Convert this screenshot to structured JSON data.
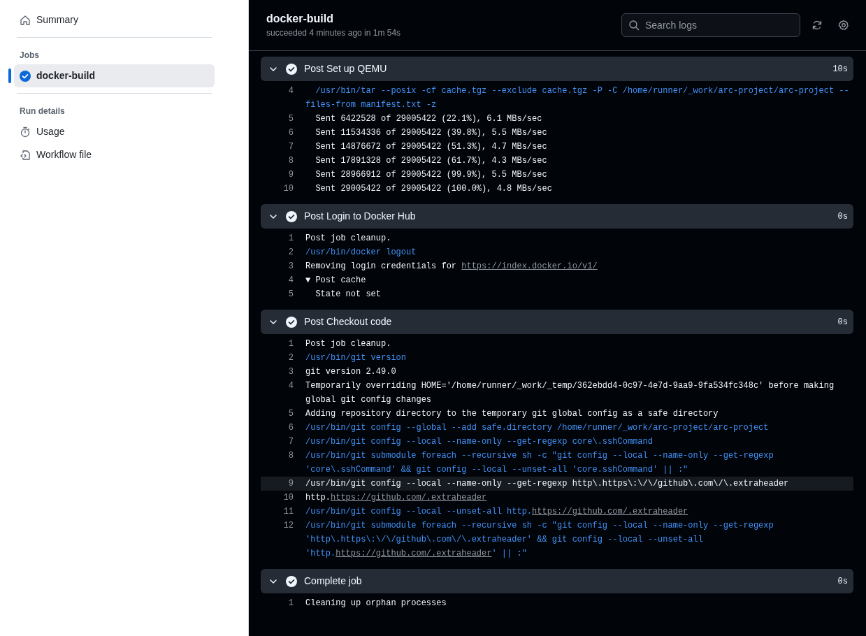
{
  "sidebar": {
    "summary": {
      "label": "Summary",
      "selected": false
    },
    "groups": [
      {
        "heading": "Jobs",
        "items": [
          {
            "kind": "job",
            "label": "docker-build",
            "succeeded": true,
            "selected": true
          }
        ]
      },
      {
        "heading": "Run details",
        "items": [
          {
            "kind": "usage",
            "label": "Usage",
            "selected": false
          },
          {
            "kind": "file",
            "label": "Workflow file",
            "selected": false
          }
        ]
      }
    ]
  },
  "header": {
    "title": "docker-build",
    "subtitle": "succeeded 4 minutes ago in 1m 54s",
    "search": {
      "placeholder": "Search logs"
    }
  },
  "steps": [
    {
      "title": "Post Set up QEMU",
      "duration": "10s",
      "succeeded": true,
      "expanded": true,
      "lines": [
        {
          "number": "4",
          "kind": "command",
          "selected": false,
          "segments": [
            {
              "kind": "text",
              "text": "  /usr/bin/tar --posix -cf cache.tgz --exclude cache.tgz -P -C /home/runner/_work/arc-project/arc-project --files-from manifest.txt -z"
            }
          ]
        },
        {
          "number": "5",
          "kind": "output",
          "selected": false,
          "segments": [
            {
              "kind": "text",
              "text": "  Sent 6422528 of 29005422 (22.1%), 6.1 MBs/sec"
            }
          ]
        },
        {
          "number": "6",
          "kind": "output",
          "selected": false,
          "segments": [
            {
              "kind": "text",
              "text": "  Sent 11534336 of 29005422 (39.8%), 5.5 MBs/sec"
            }
          ]
        },
        {
          "number": "7",
          "kind": "output",
          "selected": false,
          "segments": [
            {
              "kind": "text",
              "text": "  Sent 14876672 of 29005422 (51.3%), 4.7 MBs/sec"
            }
          ]
        },
        {
          "number": "8",
          "kind": "output",
          "selected": false,
          "segments": [
            {
              "kind": "text",
              "text": "  Sent 17891328 of 29005422 (61.7%), 4.3 MBs/sec"
            }
          ]
        },
        {
          "number": "9",
          "kind": "output",
          "selected": false,
          "segments": [
            {
              "kind": "text",
              "text": "  Sent 28966912 of 29005422 (99.9%), 5.5 MBs/sec"
            }
          ]
        },
        {
          "number": "10",
          "kind": "output",
          "selected": false,
          "segments": [
            {
              "kind": "text",
              "text": "  Sent 29005422 of 29005422 (100.0%), 4.8 MBs/sec"
            }
          ]
        }
      ]
    },
    {
      "title": "Post Login to Docker Hub",
      "duration": "0s",
      "succeeded": true,
      "expanded": true,
      "lines": [
        {
          "number": "1",
          "kind": "output",
          "selected": false,
          "segments": [
            {
              "kind": "text",
              "text": "Post job cleanup."
            }
          ]
        },
        {
          "number": "2",
          "kind": "command",
          "selected": false,
          "segments": [
            {
              "kind": "text",
              "text": "/usr/bin/docker logout"
            }
          ]
        },
        {
          "number": "3",
          "kind": "output",
          "selected": false,
          "segments": [
            {
              "kind": "text",
              "text": "Removing login credentials for "
            },
            {
              "kind": "link",
              "text": "https://index.docker.io/v1/"
            }
          ]
        },
        {
          "number": "4",
          "kind": "output",
          "selected": false,
          "segments": [
            {
              "kind": "text",
              "text": "▼ Post cache"
            }
          ]
        },
        {
          "number": "5",
          "kind": "output",
          "selected": false,
          "segments": [
            {
              "kind": "text",
              "text": "  State not set"
            }
          ]
        }
      ]
    },
    {
      "title": "Post Checkout code",
      "duration": "0s",
      "succeeded": true,
      "expanded": true,
      "lines": [
        {
          "number": "1",
          "kind": "output",
          "selected": false,
          "segments": [
            {
              "kind": "text",
              "text": "Post job cleanup."
            }
          ]
        },
        {
          "number": "2",
          "kind": "command",
          "selected": false,
          "segments": [
            {
              "kind": "text",
              "text": "/usr/bin/git version"
            }
          ]
        },
        {
          "number": "3",
          "kind": "output",
          "selected": false,
          "segments": [
            {
              "kind": "text",
              "text": "git version 2.49.0"
            }
          ]
        },
        {
          "number": "4",
          "kind": "output",
          "selected": false,
          "segments": [
            {
              "kind": "text",
              "text": "Temporarily overriding HOME='/home/runner/_work/_temp/362ebdd4-0c97-4e7d-9aa9-9fa534fc348c' before making global git config changes"
            }
          ]
        },
        {
          "number": "5",
          "kind": "output",
          "selected": false,
          "segments": [
            {
              "kind": "text",
              "text": "Adding repository directory to the temporary git global config as a safe directory"
            }
          ]
        },
        {
          "number": "6",
          "kind": "command",
          "selected": false,
          "segments": [
            {
              "kind": "text",
              "text": "/usr/bin/git config --global --add safe.directory /home/runner/_work/arc-project/arc-project"
            }
          ]
        },
        {
          "number": "7",
          "kind": "command",
          "selected": false,
          "segments": [
            {
              "kind": "text",
              "text": "/usr/bin/git config --local --name-only --get-regexp core\\.sshCommand"
            }
          ]
        },
        {
          "number": "8",
          "kind": "command",
          "selected": false,
          "segments": [
            {
              "kind": "text",
              "text": "/usr/bin/git submodule foreach --recursive sh -c \"git config --local --name-only --get-regexp 'core\\.sshCommand' && git config --local --unset-all 'core.sshCommand' || :\""
            }
          ]
        },
        {
          "number": "9",
          "kind": "output",
          "selected": true,
          "segments": [
            {
              "kind": "text",
              "text": "/usr/bin/git config --local --name-only --get-regexp http\\.https\\:\\/\\/github\\.com\\/\\.extraheader"
            }
          ]
        },
        {
          "number": "10",
          "kind": "output",
          "selected": false,
          "segments": [
            {
              "kind": "text",
              "text": "http."
            },
            {
              "kind": "link",
              "text": "https://github.com/.extraheader"
            }
          ]
        },
        {
          "number": "11",
          "kind": "command",
          "selected": false,
          "segments": [
            {
              "kind": "text",
              "text": "/usr/bin/git config --local --unset-all http."
            },
            {
              "kind": "link",
              "text": "https://github.com/.extraheader"
            }
          ]
        },
        {
          "number": "12",
          "kind": "command",
          "selected": false,
          "segments": [
            {
              "kind": "text",
              "text": "/usr/bin/git submodule foreach --recursive sh -c \"git config --local --name-only --get-regexp 'http\\.https\\:\\/\\/github\\.com\\/\\.extraheader' && git config --local --unset-all 'http."
            },
            {
              "kind": "link",
              "text": "https://github.com/.extraheader"
            },
            {
              "kind": "text",
              "text": "' || :\""
            }
          ]
        }
      ]
    },
    {
      "title": "Complete job",
      "duration": "0s",
      "succeeded": true,
      "expanded": true,
      "lines": [
        {
          "number": "1",
          "kind": "output",
          "selected": false,
          "segments": [
            {
              "kind": "text",
              "text": "Cleaning up orphan processes"
            }
          ]
        }
      ]
    }
  ]
}
